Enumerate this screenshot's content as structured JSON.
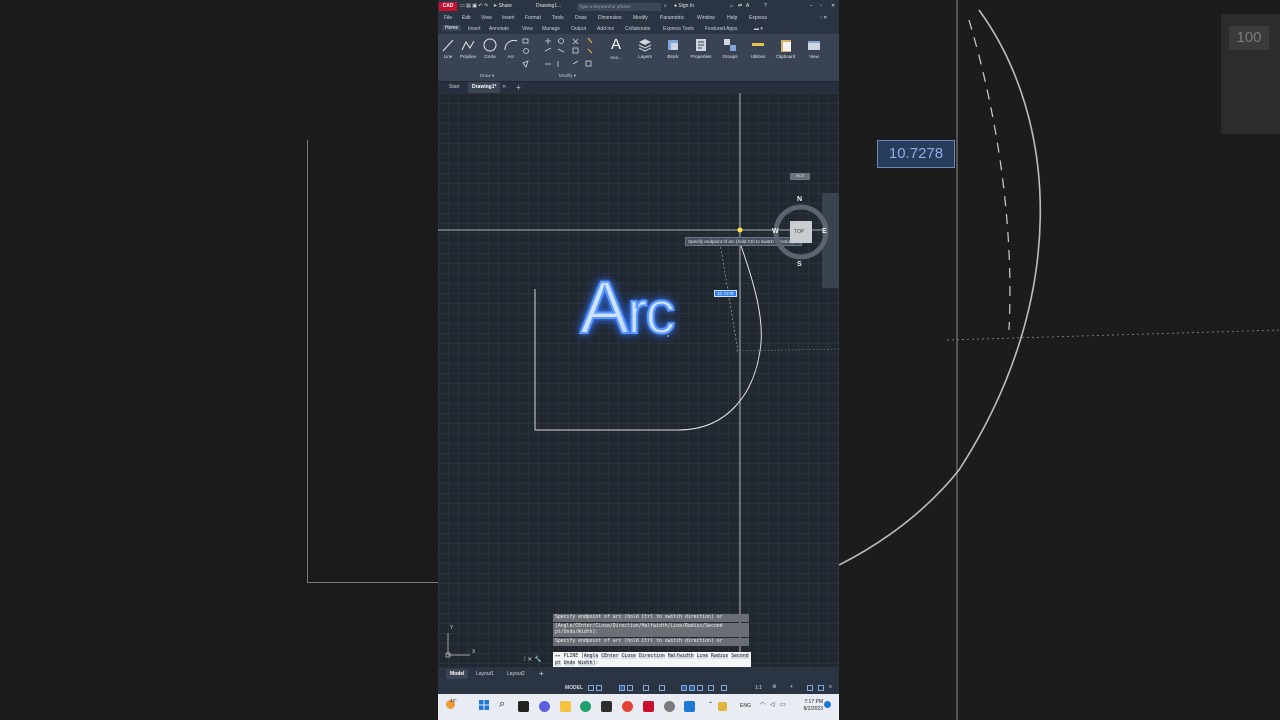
{
  "title_bar": {
    "app_badge": "CAD",
    "share": "Share",
    "doc_title": "Drawing1...",
    "search_placeholder": "Type a keyword or phrase",
    "sign_in": "Sign In"
  },
  "menu": [
    "File",
    "Edit",
    "View",
    "Insert",
    "Format",
    "Tools",
    "Draw",
    "Dimension",
    "Modify",
    "Parametric",
    "Window",
    "Help",
    "Express"
  ],
  "ribbon_tabs": {
    "active": "Home",
    "items": [
      "Insert",
      "Annotate",
      "View",
      "Manage",
      "Output",
      "Add-ins",
      "Collaborate",
      "Express Tools",
      "Featured Apps"
    ]
  },
  "ribbon": {
    "draw_tools": [
      "Line",
      "Polyline",
      "Circle",
      "Arc"
    ],
    "tools": [
      "Ann...",
      "Layers",
      "Block",
      "Properties",
      "Groups",
      "Utilities",
      "Clipboard",
      "View"
    ],
    "panels": {
      "draw": "Draw",
      "modify": "Modify"
    }
  },
  "doc_tabs": {
    "start": "Start",
    "current": "Drawing1*"
  },
  "canvas": {
    "overlay_title_first": "A",
    "overlay_title_rest": "rc",
    "tooltip": "Specify endpoint of arc (hold Ctrl to switch direction) or",
    "dim_value": "10.7278",
    "viewcube": {
      "n": "N",
      "s": "S",
      "e": "E",
      "w": "W",
      "face": "TOP",
      "wcs": "WCS"
    },
    "ucs": {
      "y": "Y",
      "x": "X"
    }
  },
  "command_line": {
    "history": [
      "Specify endpoint of arc (hold Ctrl to switch direction) or",
      "[Angle/CEnter/CLose/Direction/Halfwidth/Line/Radius/Second pt/Undo/Width]:",
      "Specify endpoint of arc (hold Ctrl to switch direction) or"
    ],
    "prompt_cmd": "PLINE",
    "options": [
      "Angle",
      "CEnter",
      "CLose",
      "Direction",
      "Halfwidth",
      "Line",
      "Radius",
      "Second pt",
      "Undo",
      "Width"
    ],
    "prompt_end": "]:"
  },
  "layout_tabs": [
    "Model",
    "Layout1",
    "Layout2"
  ],
  "status": {
    "model": "MODEL",
    "scale": "1:1"
  },
  "taskbar": {
    "weather": "42°",
    "language": "ENG",
    "time": "7:17 PM",
    "date": "8/2/2023"
  },
  "right_panel": {
    "dim_value": "10.7278",
    "partial_label": "100"
  }
}
